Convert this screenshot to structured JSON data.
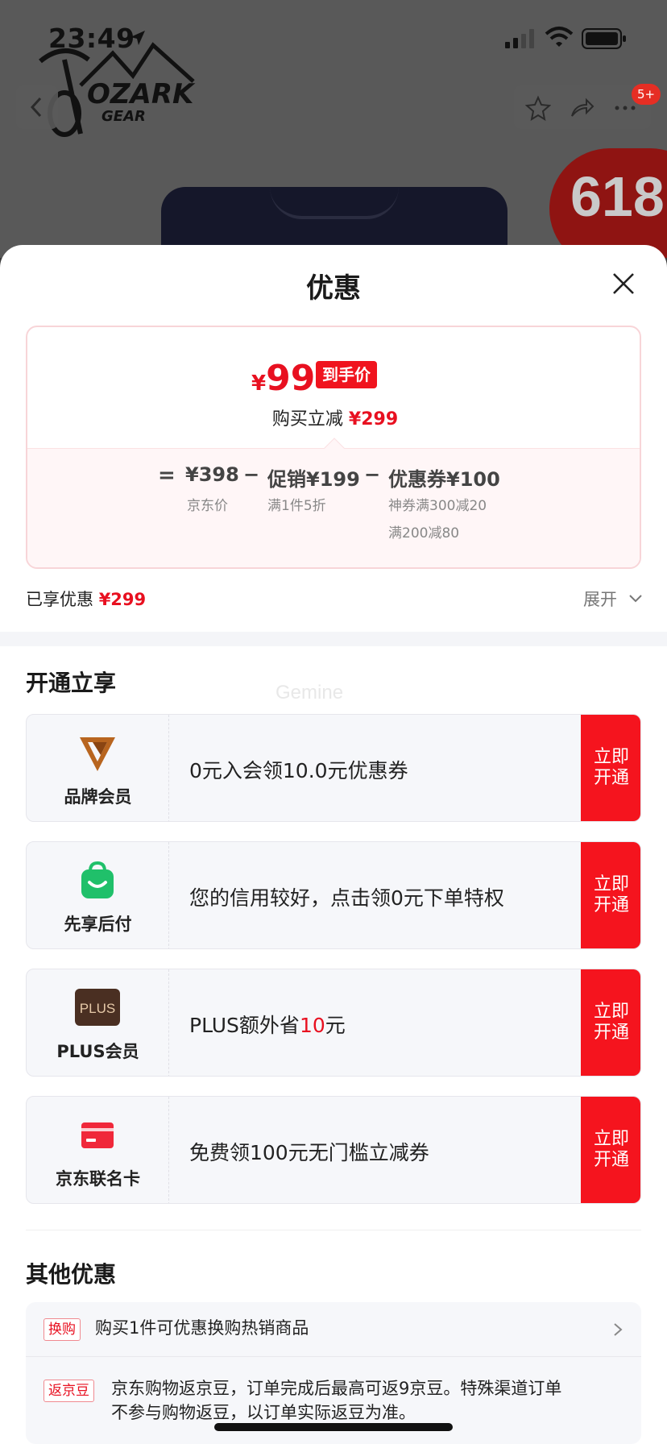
{
  "status_bar": {
    "time": "23:49"
  },
  "background_page": {
    "brand_logo": {
      "line1": "OZARK",
      "line2": "GEAR"
    },
    "notification_badge": "5+",
    "promo_badge": "618"
  },
  "sheet": {
    "title": "优惠",
    "price_card": {
      "final_currency": "¥",
      "final_price": "99",
      "final_tag": "到手价",
      "reduce_label": "购买立减",
      "reduce_amount": "¥299",
      "equals": "=",
      "calc": [
        {
          "value": "¥398",
          "sub": [
            "京东价"
          ]
        },
        {
          "op": "−",
          "value": "促销¥199",
          "sub": [
            "满1件5折"
          ]
        },
        {
          "op": "−",
          "value": "优惠券¥100",
          "sub": [
            "神券满300减20",
            "满200减80"
          ]
        }
      ]
    },
    "enjoyed": {
      "label": "已享优惠",
      "amount": "¥299",
      "expand": "展开"
    },
    "open_section": {
      "title": "开通立享",
      "watermark": "Gemine",
      "items": [
        {
          "name": "品牌会员",
          "icon": "brand-member-icon",
          "desc": "0元入会领10.0元优惠券",
          "button": [
            "立即",
            "开通"
          ]
        },
        {
          "name": "先享后付",
          "icon": "pay-later-bag-icon",
          "desc": "您的信用较好，点击领0元下单特权",
          "button": [
            "立即",
            "开通"
          ]
        },
        {
          "name": "PLUS会员",
          "icon": "plus-icon",
          "icon_text": "PLUS",
          "desc_prefix": "PLUS额外省",
          "desc_highlight": "10",
          "desc_suffix": "元",
          "button": [
            "立即",
            "开通"
          ]
        },
        {
          "name": "京东联名卡",
          "icon": "credit-card-icon",
          "desc": "免费领100元无门槛立减券",
          "button": [
            "立即",
            "开通"
          ]
        }
      ]
    },
    "other_section": {
      "title": "其他优惠",
      "items": [
        {
          "tag": "换购",
          "text": "购买1件可优惠换购热销商品"
        },
        {
          "tag": "返京豆",
          "text_line1": "京东购物返京豆，订单完成后最高可返9京豆。特殊渠道订单",
          "text_line2": "不参与购物返豆，以订单实际返豆为准。"
        }
      ]
    }
  },
  "colors": {
    "accent_red": "#f5141e",
    "price_red": "#e81020",
    "card_bg": "#f6f7fa"
  }
}
